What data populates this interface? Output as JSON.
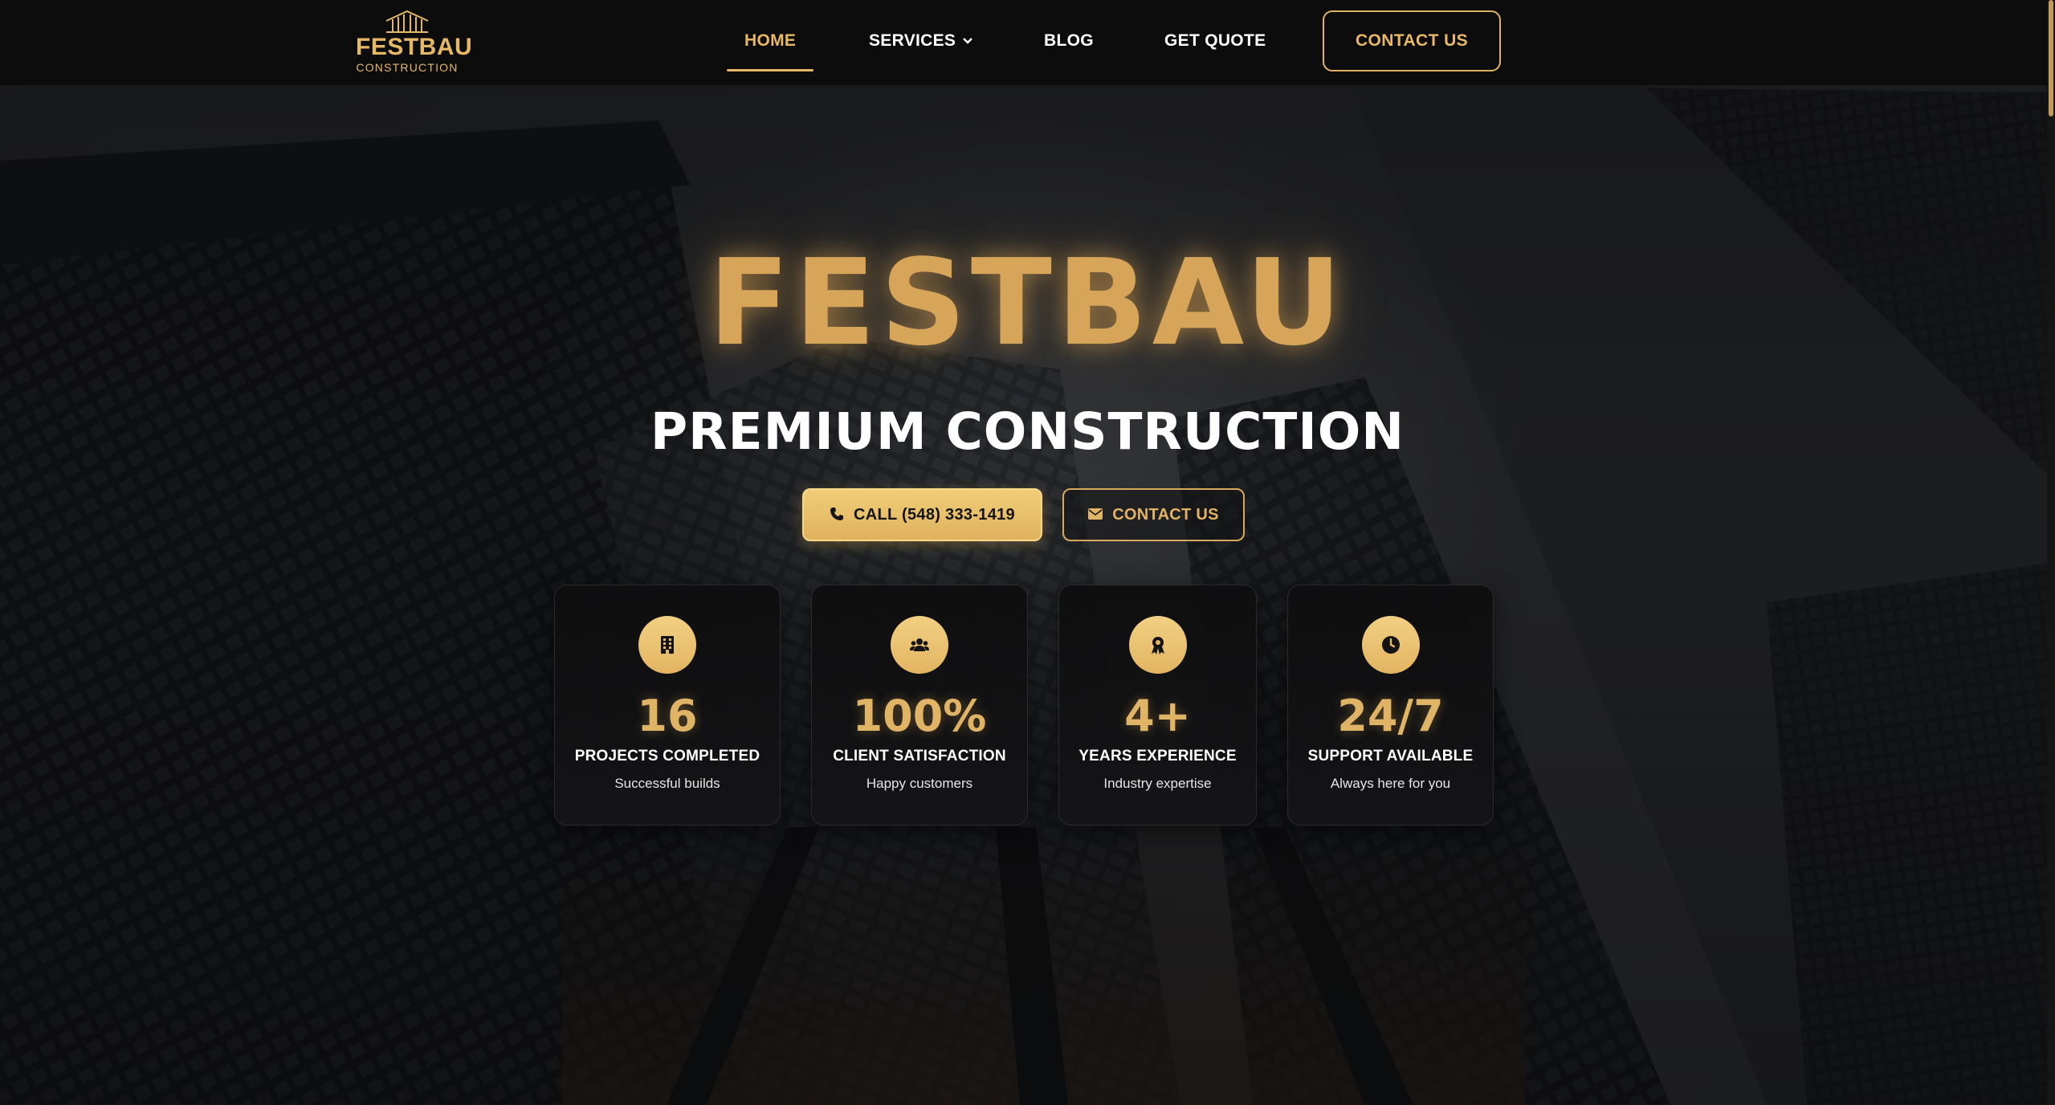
{
  "brand": {
    "name": "FESTBAU",
    "subtitle": "CONSTRUCTION",
    "accent_color": "#e9b866"
  },
  "nav": {
    "items": [
      {
        "label": "HOME",
        "active": true
      },
      {
        "label": "SERVICES",
        "has_dropdown": true,
        "icon": "chevron-down-icon"
      },
      {
        "label": "BLOG"
      },
      {
        "label": "GET QUOTE"
      }
    ],
    "cta_label": "CONTACT US"
  },
  "hero": {
    "title": "FESTBAU",
    "subtitle": "PREMIUM CONSTRUCTION",
    "call_button": {
      "label": "CALL (548) 333-1419",
      "icon": "phone-icon"
    },
    "contact_button": {
      "label": "CONTACT US",
      "icon": "envelope-icon"
    }
  },
  "stats": [
    {
      "icon": "building-icon",
      "value": "16",
      "label": "PROJECTS COMPLETED",
      "desc": "Successful builds"
    },
    {
      "icon": "users-icon",
      "value": "100%",
      "label": "CLIENT SATISFACTION",
      "desc": "Happy customers"
    },
    {
      "icon": "award-icon",
      "value": "4+",
      "label": "YEARS EXPERIENCE",
      "desc": "Industry expertise"
    },
    {
      "icon": "clock-icon",
      "value": "24/7",
      "label": "SUPPORT AVAILABLE",
      "desc": "Always here for you"
    }
  ]
}
